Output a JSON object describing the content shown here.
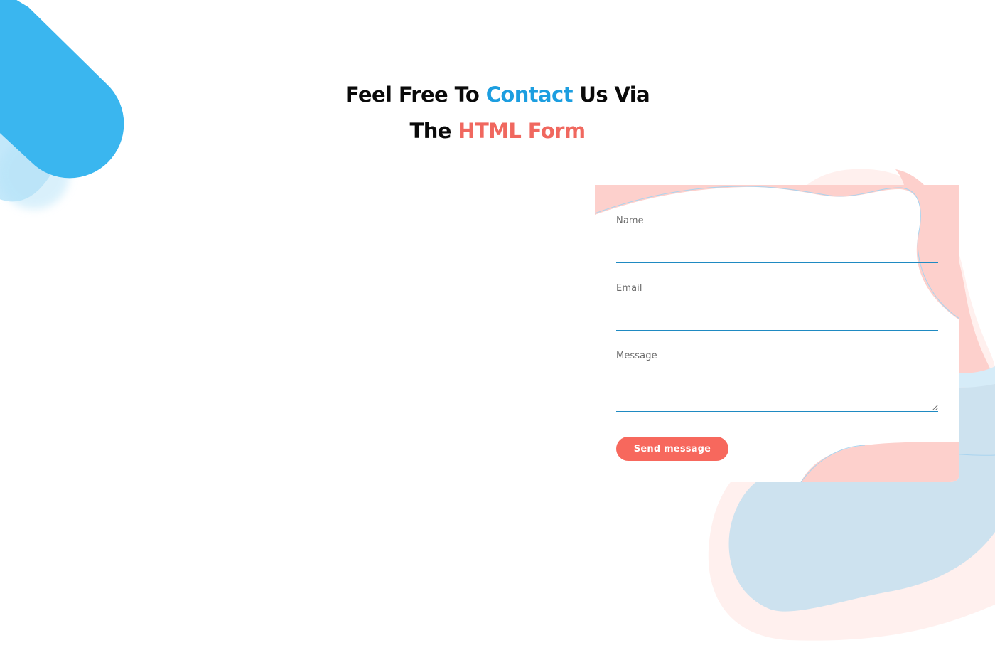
{
  "heading": {
    "part1": "Feel Free To ",
    "highlight1": "Contact",
    "part2": " Us Via",
    "part3": "The ",
    "highlight2": "HTML Form"
  },
  "form": {
    "name_label": "Name",
    "email_label": "Email",
    "message_label": "Message",
    "name_value": "",
    "email_value": "",
    "message_value": "",
    "submit_label": "Send message"
  },
  "colors": {
    "accent_blue": "#1c9ee0",
    "accent_coral": "#f0685f",
    "button": "#f7685d",
    "input_underline": "#1f8ac2",
    "blob_blue": "#3ab6ef",
    "blob_pink": "#fdd0cc"
  },
  "decorations": {
    "top_left": "blue-pill-shape",
    "bottom_right": "pink-blue-wave-blob"
  }
}
